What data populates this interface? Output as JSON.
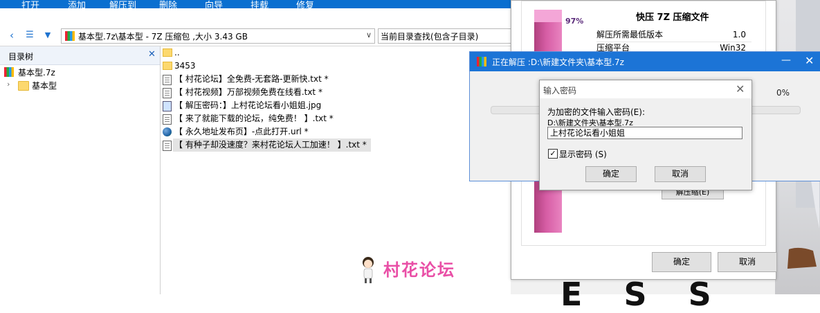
{
  "toolbar": {
    "open": "打开",
    "add": "添加",
    "extract_to": "解压到",
    "delete": "删除",
    "wizard": "向导",
    "mount": "挂载",
    "repair": "修复"
  },
  "address_bar": {
    "path": "基本型.7z\\基本型 - 7Z 压缩包 ,大小 3.43 GB",
    "search_placeholder": "当前目录查找(包含子目录)"
  },
  "tree": {
    "header": "目录树",
    "close": "✕",
    "root": "基本型.7z",
    "child": "基本型"
  },
  "files": [
    {
      "name": "..",
      "icon": "folder-icon"
    },
    {
      "name": "3453",
      "icon": "folder-icon"
    },
    {
      "name": "【 村花论坛】全免费-无套路-更新快.txt *",
      "icon": "text-file-icon"
    },
    {
      "name": "【 村花视频】万部视频免费在线看.txt *",
      "icon": "text-file-icon"
    },
    {
      "name": "【 解压密码：】上村花论坛看小姐姐.jpg",
      "icon": "image-file-icon"
    },
    {
      "name": "【 来了就能下载的论坛，纯免费！ 】.txt *",
      "icon": "text-file-icon"
    },
    {
      "name": "【 永久地址发布页】-点此打开.url *",
      "icon": "globe-icon"
    },
    {
      "name": "【 有种子却没速度？来村花论坛人工加速！ 】.txt *",
      "icon": "text-file-icon"
    }
  ],
  "watermark": "村花论坛",
  "properties": {
    "title": "快压 7Z 压缩文件",
    "percent": "97%",
    "rows": [
      {
        "key": "解压所需最低版本",
        "value": "1.0"
      },
      {
        "key": "压缩平台",
        "value": "Win32"
      }
    ],
    "extract_button": "解压缩(E)",
    "ok": "确定",
    "cancel": "取消"
  },
  "extract_window": {
    "title": "正在解压 :D:\\新建文件夹\\基本型.7z",
    "percent": "0%",
    "progress": 0
  },
  "password_dialog": {
    "title": "输入密码",
    "prompt": "为加密的文件输入密码(E):",
    "path": "D:\\新建文件夹\\基本型.7z",
    "password": "上村花论坛看小姐姐",
    "show_password_label": "显示密码 (S)",
    "show_password_checked": true,
    "ok": "确定",
    "cancel": "取消"
  },
  "background_text": "E S S",
  "colors": {
    "title_bar": "#1c74d6",
    "toolbar": "#0a6fd0",
    "watermark": "#e94fa6",
    "bar": "#d75ea6"
  }
}
